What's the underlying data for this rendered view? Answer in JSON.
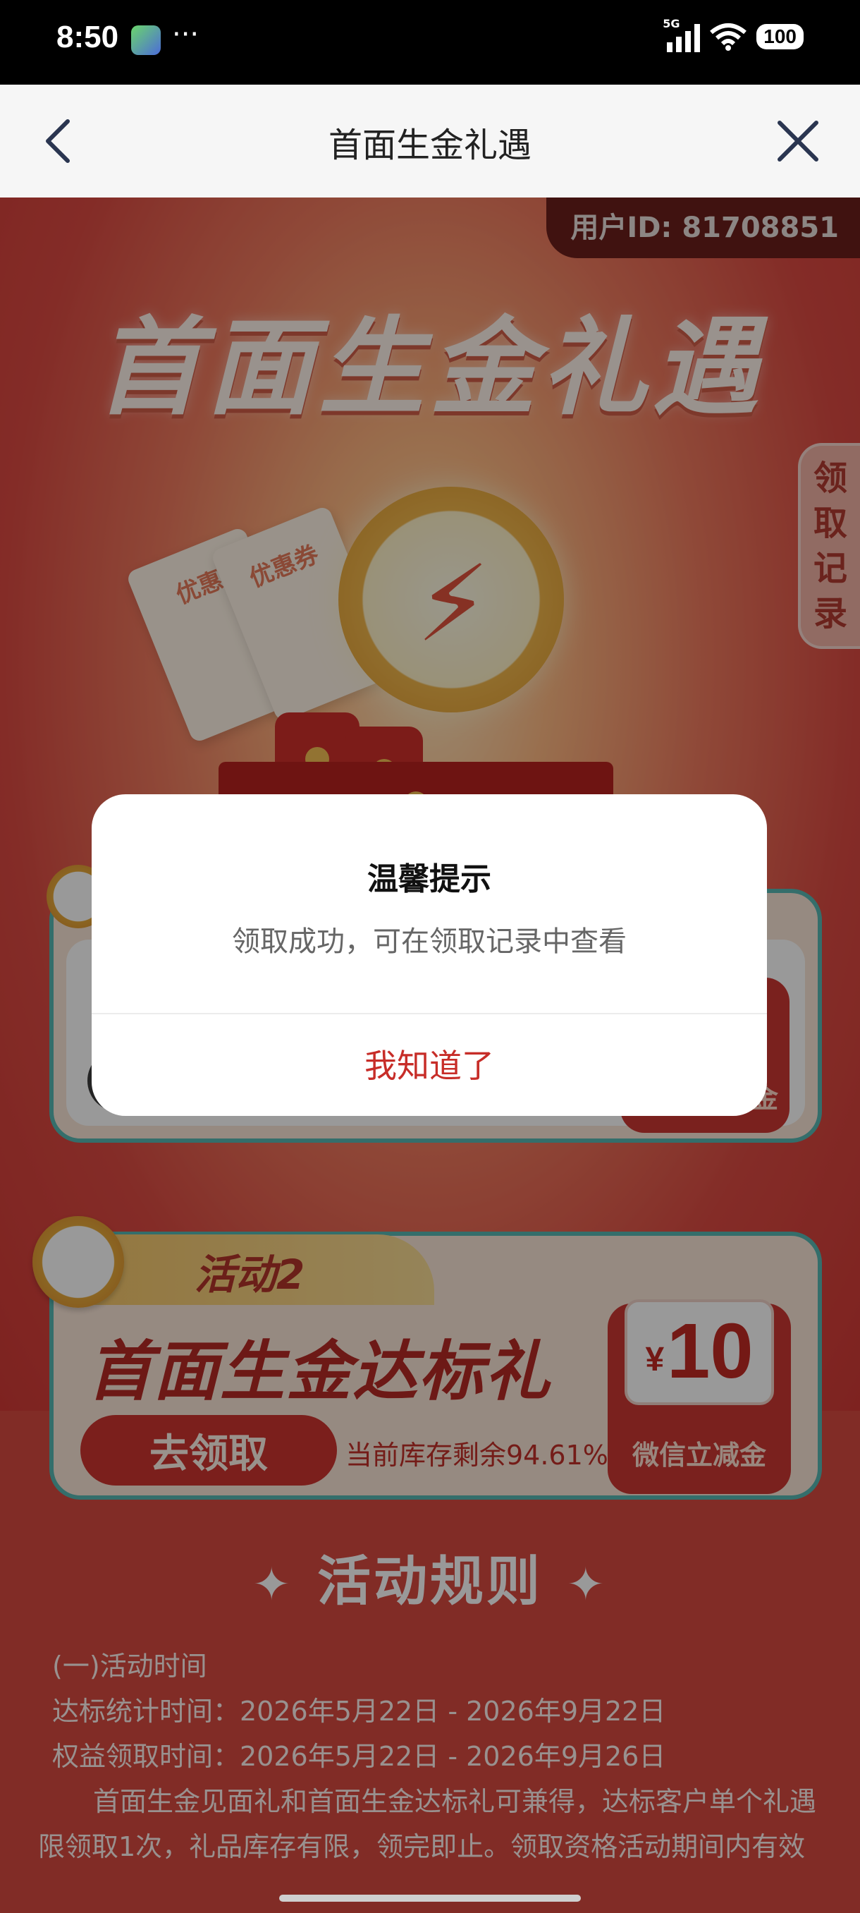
{
  "status_bar": {
    "time": "8:50",
    "more": "···",
    "network": "5G",
    "battery": "100"
  },
  "nav": {
    "title": "首面生金礼遇"
  },
  "header": {
    "user_id": "用户ID: 81708851",
    "hero_title": "首面生金礼遇",
    "side_tab": "领取记录"
  },
  "illustration": {
    "ticket_label_1": "优惠",
    "ticket_label_2": "优惠券"
  },
  "activity1": {
    "coupon_label": "金"
  },
  "activity2": {
    "tag": "活动2",
    "title": "首面生金达标礼",
    "button": "去领取",
    "stock": "当前库存剩余94.61%",
    "amount": "10",
    "currency": "¥",
    "coupon_label": "微信立减金"
  },
  "rules": {
    "title": "活动规则",
    "lines": [
      "(一)活动时间",
      "达标统计时间：2026年5月22日 - 2026年9月22日",
      "权益领取时间：2026年5月22日 - 2026年9月26日",
      "　首面生金见面礼和首面生金达标礼可兼得，达标客户单个礼遇",
      "限领取1次，礼品库存有限，领完即止。领取资格活动期间内有效"
    ]
  },
  "dialog": {
    "title": "温馨提示",
    "message": "领取成功，可在领取记录中查看",
    "button": "我知道了"
  }
}
